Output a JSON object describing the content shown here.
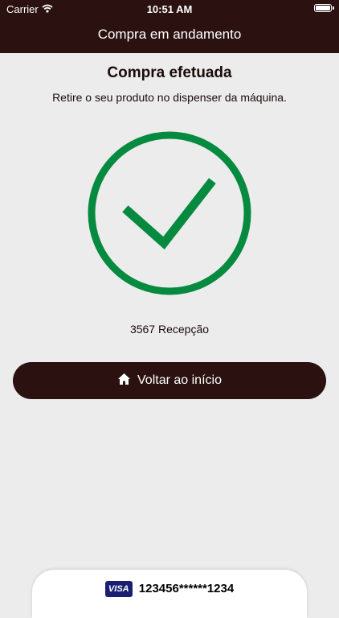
{
  "status_bar": {
    "carrier": "Carrier",
    "time": "10:51 AM"
  },
  "nav": {
    "title": "Compra em andamento"
  },
  "main": {
    "title": "Compra efetuada",
    "subtitle": "Retire o seu produto no dispenser da máquina.",
    "machine_info": "3567 Recepção",
    "home_button_label": "Voltar ao início"
  },
  "payment": {
    "card_brand": "VISA",
    "card_number": "123456******1234"
  },
  "colors": {
    "header": "#2b1210",
    "success": "#058a40",
    "background": "#ececec"
  },
  "icons": [
    "wifi-icon",
    "battery-icon",
    "check-circle-icon",
    "home-icon",
    "visa-logo-icon"
  ]
}
